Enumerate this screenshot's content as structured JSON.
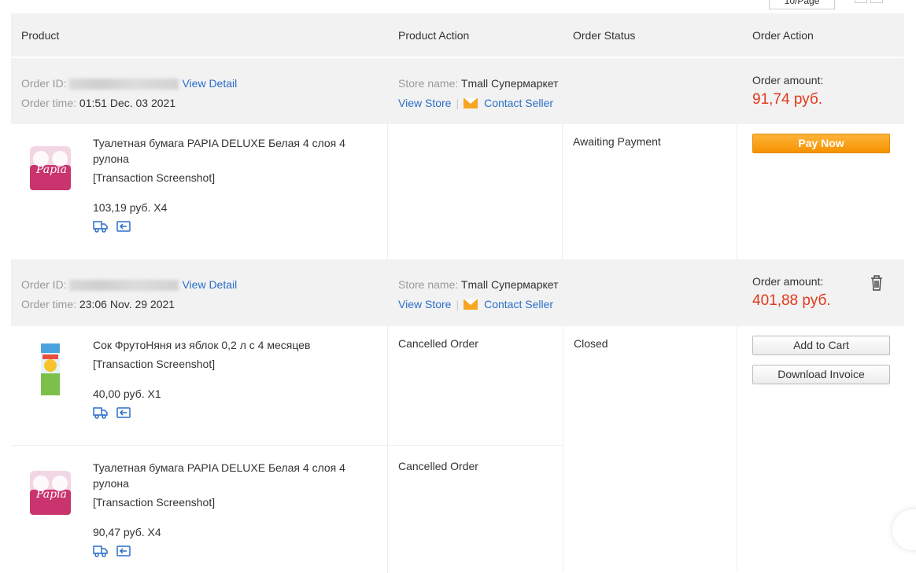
{
  "top": {
    "per_page_label": "10/Page"
  },
  "header": {
    "product": "Product",
    "product_action": "Product Action",
    "order_status": "Order Status",
    "order_action": "Order Action"
  },
  "labels": {
    "order_id": "Order ID:",
    "order_time": "Order time:",
    "view_detail": "View Detail",
    "store_name": "Store name:",
    "view_store": "View Store",
    "separator": "|",
    "contact_seller": "Contact Seller",
    "order_amount": "Order amount:",
    "transaction_screenshot": "[Transaction Screenshot]"
  },
  "orders": [
    {
      "time": "01:51 Dec. 03 2021",
      "store": "Tmall Супермаркет",
      "amount": "91,74 руб.",
      "status": "Awaiting Payment",
      "action_primary": "Pay Now",
      "items": [
        {
          "title": "Туалетная бумага PAPIA DELUXE Белая 4 слоя 4 рулона",
          "price": "103,19 руб. X4",
          "product_action": "",
          "thumb": "toilet-paper"
        }
      ]
    },
    {
      "time": "23:06 Nov. 29 2021",
      "store": "Tmall Супермаркет",
      "amount": "401,88 руб.",
      "status": "Closed",
      "actions": [
        "Add to Cart",
        "Download Invoice"
      ],
      "items": [
        {
          "title": "Сок ФрутоНяня из яблок 0,2 л с 4 месяцев",
          "price": "40,00 руб. X1",
          "product_action": "Cancelled Order",
          "thumb": "juice-box"
        },
        {
          "title": "Туалетная бумага PAPIA DELUXE Белая 4 слоя 4 рулона",
          "price": "90,47 руб. X4",
          "product_action": "Cancelled Order",
          "thumb": "toilet-paper"
        }
      ]
    }
  ],
  "colors": {
    "link": "#2a6ec8",
    "amount": "#e0391b",
    "pay_button": "#f59200",
    "header_bg": "#f2f2f2"
  }
}
